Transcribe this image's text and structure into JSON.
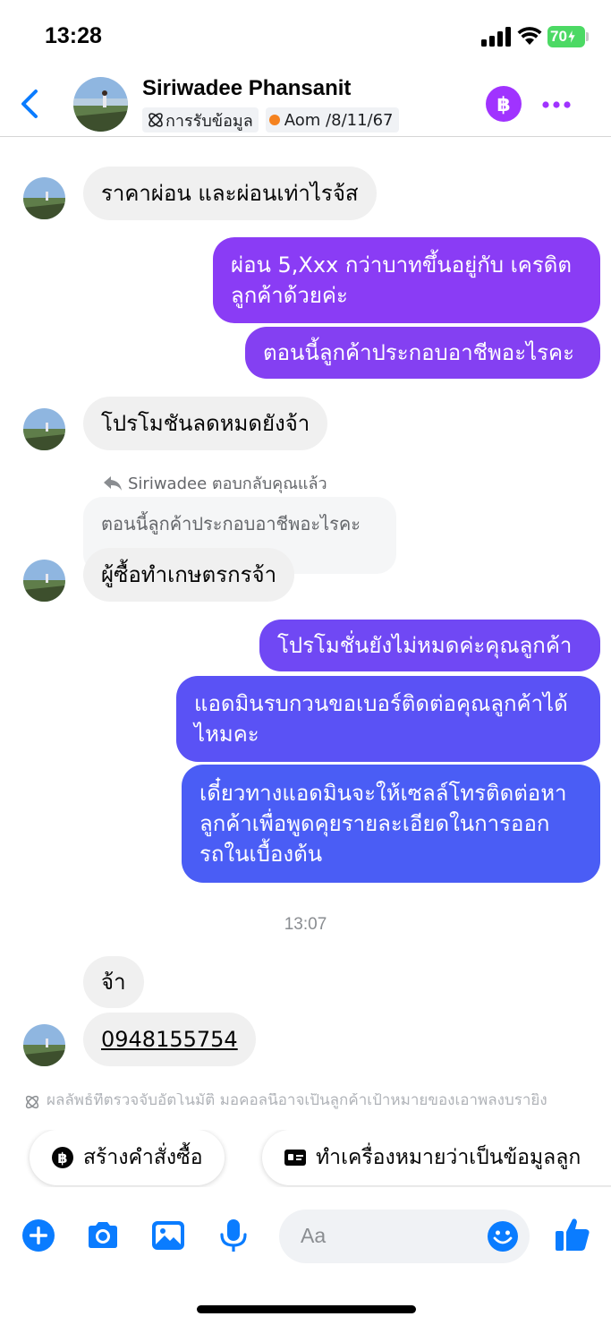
{
  "status_bar": {
    "time": "13:28",
    "battery": "70"
  },
  "header": {
    "contact_name": "Siriwadee Phansanit",
    "tag_info": "การรับข้อมูล",
    "tag_note": "Aom /8/11/67"
  },
  "messages": {
    "m1": "ราคาผ่อน และผ่อนเท่าไรจ้ส",
    "m2_line1": "ผ่อน 5,Xxx กว่าบาทขึ้นอยู่กับ เครดิต",
    "m2_line2": "ลูกค้าด้วยค่ะ",
    "m3": "ตอนนี้ลูกค้าประกอบอาชีพอะไรคะ",
    "m4": "โปรโมชันลดหมดยังจ้า",
    "reply_label": "Siriwadee ตอบกลับคุณแล้ว",
    "quoted": "ตอนนี้ลูกค้าประกอบอาชีพอะไรคะ",
    "m5": "ผู้ซื้อทำเกษตรกรจ้า",
    "m6": "โปรโมชั่นยังไม่หมดค่ะคุณลูกค้า",
    "m7_line1": "แอดมินรบกวนขอเบอร์ติดต่อคุณลูกค้าได้",
    "m7_line2": "ไหมคะ",
    "m8_line1": "เดี๋ยวทางแอดมินจะให้เซลล์โทรติดต่อหา",
    "m8_line2": "ลูกค้าเพื่อพูดคุยรายละเอียดในการออก",
    "m8_line3": "รถในเบื้องต้น",
    "timestamp": "13:07",
    "m9": "จ้า",
    "m10": "0948155754",
    "faded_note": "ผลลัพธ์ที่ตรวจจับอัตโนมัติ มอคอลนี้อาจเป็นลูกค้าเป้าหมายของเอาพลงบรายิง"
  },
  "quick_actions": {
    "create_order": "สร้างคำสั่งซื้อ",
    "mark_lead": "ทำเครื่องหมายว่าเป็นข้อมูลลูก"
  },
  "composer": {
    "placeholder": "Aa"
  },
  "colors": {
    "accent": "#0a7cff",
    "purple_out": "#8a3cf5",
    "blue_out": "#4a5df5"
  }
}
